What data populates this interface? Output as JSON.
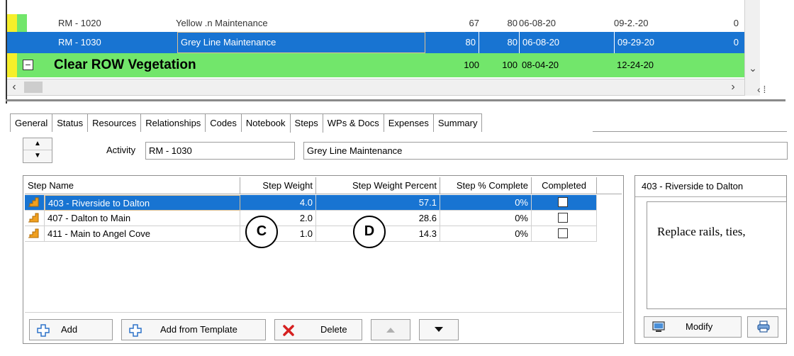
{
  "activity_grid": {
    "rows": [
      {
        "id": "RM - 1020",
        "name": "Yellow .n  Maintenance",
        "pct": "67",
        "weight": "80",
        "start": "06-08-20",
        "finish": "09-2.-20",
        "extra": "0"
      },
      {
        "id": "RM - 1030",
        "name": "Grey Line Maintenance",
        "pct": "80",
        "weight": "80",
        "start": "06-08-20",
        "finish": "09-29-20",
        "extra": "0"
      }
    ],
    "wbs": {
      "expander": "−",
      "name": "Clear ROW Vegetation",
      "pct": "100",
      "weight": "100",
      "start": "08-04-20",
      "finish": "12-24-20"
    },
    "scroll_left": "‹",
    "scroll_right": "›",
    "scroll_down": "⌄",
    "torn_edge": "‹ ⁞"
  },
  "tabs": [
    "General",
    "Status",
    "Resources",
    "Relationships",
    "Codes",
    "Notebook",
    "Steps",
    "WPs & Docs",
    "Expenses",
    "Summary"
  ],
  "active_tab": "Steps",
  "activity": {
    "label": "Activity",
    "id": "RM - 1030",
    "name": "Grey Line Maintenance"
  },
  "steps": {
    "headers": [
      "Step Name",
      "Step Weight",
      "Step Weight Percent",
      "Step % Complete",
      "Completed"
    ],
    "rows": [
      {
        "name": "403 - Riverside to Dalton",
        "weight": "4.0",
        "weight_pct": "57.1",
        "pct_complete": "0%"
      },
      {
        "name": "407 - Dalton to Main",
        "weight": "2.0",
        "weight_pct": "28.6",
        "pct_complete": "0%"
      },
      {
        "name": "411 - Main to Angel Cove",
        "weight": "1.0",
        "weight_pct": "14.3",
        "pct_complete": "0%"
      }
    ]
  },
  "buttons": {
    "add": "Add",
    "add_from_template": "Add from Template",
    "delete": "Delete",
    "modify": "Modify"
  },
  "callouts": {
    "c": "C",
    "d": "D"
  },
  "detail_panel": {
    "title": "403 - Riverside to Dalton",
    "text": "Replace rails, ties,"
  },
  "colors": {
    "selection_blue": "#1874d2",
    "wbs_green": "#72e66b",
    "delete_red": "#d62020",
    "add_blue": "#2d72c9",
    "step_icon_orange": "#f0a020"
  }
}
